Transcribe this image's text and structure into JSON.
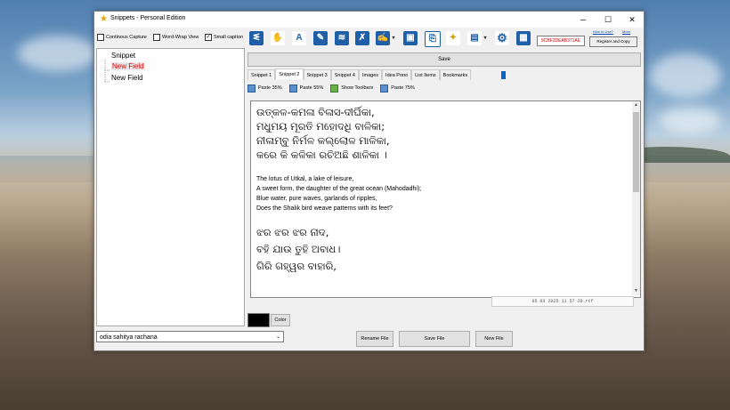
{
  "window": {
    "title": "Snippets - Personal Edition",
    "minimize": "─",
    "maximize": "☐",
    "close": "✕"
  },
  "options": {
    "continuous_capture": "Continous Capture",
    "word_wrap": "Word-Wrap View",
    "small_caption": "Small caption",
    "small_caption_checked": true
  },
  "toolbar": {
    "icons": [
      "translate-icon",
      "hand-icon",
      "font-a-icon",
      "edit-pen-icon",
      "format-icon",
      "eraser-icon",
      "brush-icon",
      "save-disk-icon",
      "clipboard-icon",
      "highlight-icon",
      "book-icon",
      "settings-icon"
    ]
  },
  "registration": {
    "serial": "9CBF2DEAB371AE",
    "register_label": "Register and Copy",
    "how_to_use": "How to Use?",
    "more": "More"
  },
  "tree": {
    "items": [
      {
        "label": "Snippet",
        "selected": false
      },
      {
        "label": "New Field",
        "selected": true
      },
      {
        "label": "New Field",
        "selected": false
      }
    ]
  },
  "save_label": "Save",
  "tabs": [
    "Snippet 1",
    "Snippet 2",
    "Snippet 3",
    "Snippet 4",
    "Images",
    "Idea Pono",
    "List Items",
    "Bookmarks"
  ],
  "active_tab": 1,
  "paste": {
    "paste35": "Paste 35%",
    "paste55": "Paste 55%",
    "show_toolbars": "Show Toolbars",
    "paste75": "Paste 75%"
  },
  "editor": {
    "odia1": [
      "ଉତ୍କଳ-କମଳା ବିଳାସ-ଦୀର୍ଘିକା,",
      "ମଧୁମୟ ମୂରତି ମହୋଦଧି ବାଳିକା;",
      "ନୀଳାମ୍ବୁ ନିର୍ମଳ କଲ୍ଲୋଳ ମାଳିକା,",
      "କରେ କି କଳିକା ରଚିଅଛି ଶାଳିକା ।"
    ],
    "english": [
      "The lotus of Utkal, a lake of leisure,",
      "A sweet form, the daughter of the great ocean (Mahodadhi);",
      "Blue water, pure waves, garlands of ripples,",
      "Does the Shalik bird weave patterns with its feet?"
    ],
    "odia2": [
      "ଝର ଝର ଝର ନାଦ,",
      "ବହି ଯାଉ ତୁହି ଅବାଧ।",
      "ଗିରି ଗହ୍ୱର ବାହାରି,"
    ]
  },
  "timestamp": "05 03 2025 11 57 29.rtf",
  "color_label": "Color",
  "file": {
    "current": "odia sahitya rachana",
    "rename": "Rename File",
    "save": "Save File",
    "new": "New File"
  }
}
